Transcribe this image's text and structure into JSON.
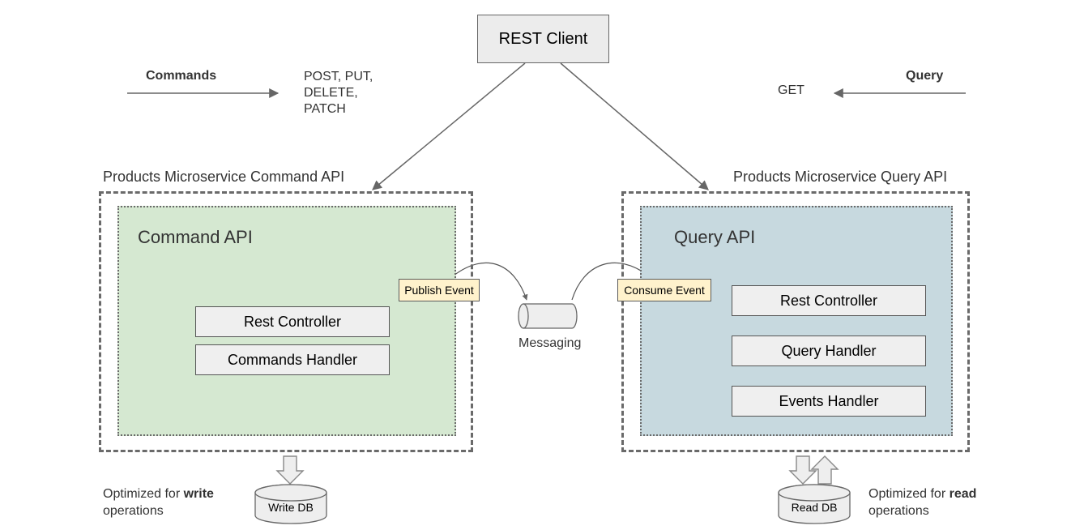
{
  "rest_client": "REST Client",
  "commands_arrow_label": "Commands",
  "commands_methods": "POST, PUT,\nDELETE,\nPATCH",
  "query_arrow_label": "Query",
  "query_method": "GET",
  "command_outer_title": "Products Microservice Command API",
  "query_outer_title": "Products Microservice Query API",
  "command_inner_title": "Command API",
  "query_inner_title": "Query API",
  "cmd_boxes": {
    "rest_controller": "Rest Controller",
    "commands_handler": "Commands Handler"
  },
  "qry_boxes": {
    "rest_controller": "Rest Controller",
    "query_handler": "Query Handler",
    "events_handler": "Events Handler"
  },
  "publish_label": "Publish Event",
  "consume_label": "Consume Event",
  "messaging_label": "Messaging",
  "write_db_label": "Write DB",
  "read_db_label": "Read DB",
  "write_opt_prefix": "Optimized for ",
  "write_opt_bold": "write",
  "write_opt_suffix": "\noperations",
  "read_opt_prefix": "Optimized for ",
  "read_opt_bold": "read",
  "read_opt_suffix": "\noperations"
}
